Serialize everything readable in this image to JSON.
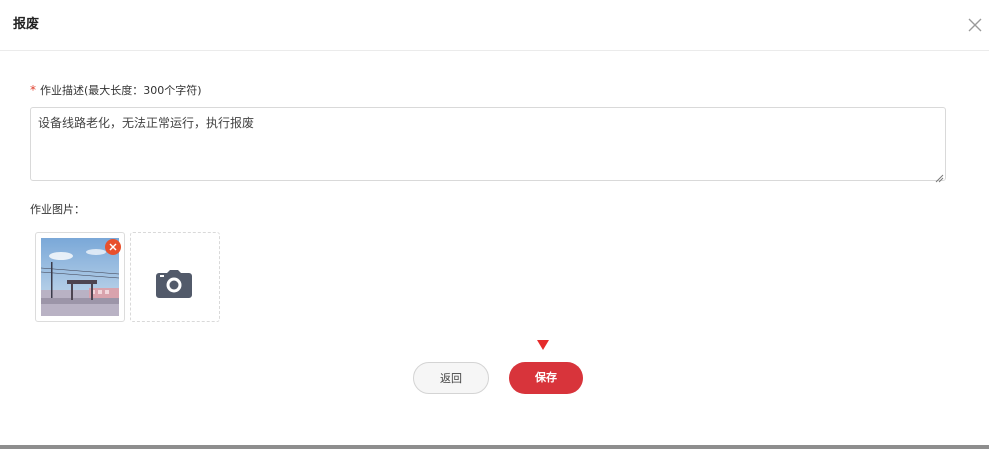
{
  "dialog": {
    "title": "报废",
    "close_icon": "close-icon"
  },
  "form": {
    "required_mark": "*",
    "description_label": "作业描述(最大长度：300个字符)",
    "description_value": "设备线路老化，无法正常运行，执行报废",
    "pictures_label": "作业图片：",
    "thumbnail_delete_icon": "close-icon",
    "upload_icon": "camera-icon"
  },
  "actions": {
    "back_label": "返回",
    "save_label": "保存"
  },
  "colors": {
    "accent": "#d8343b",
    "required": "#e0402f",
    "delete_badge": "#e8502c"
  }
}
